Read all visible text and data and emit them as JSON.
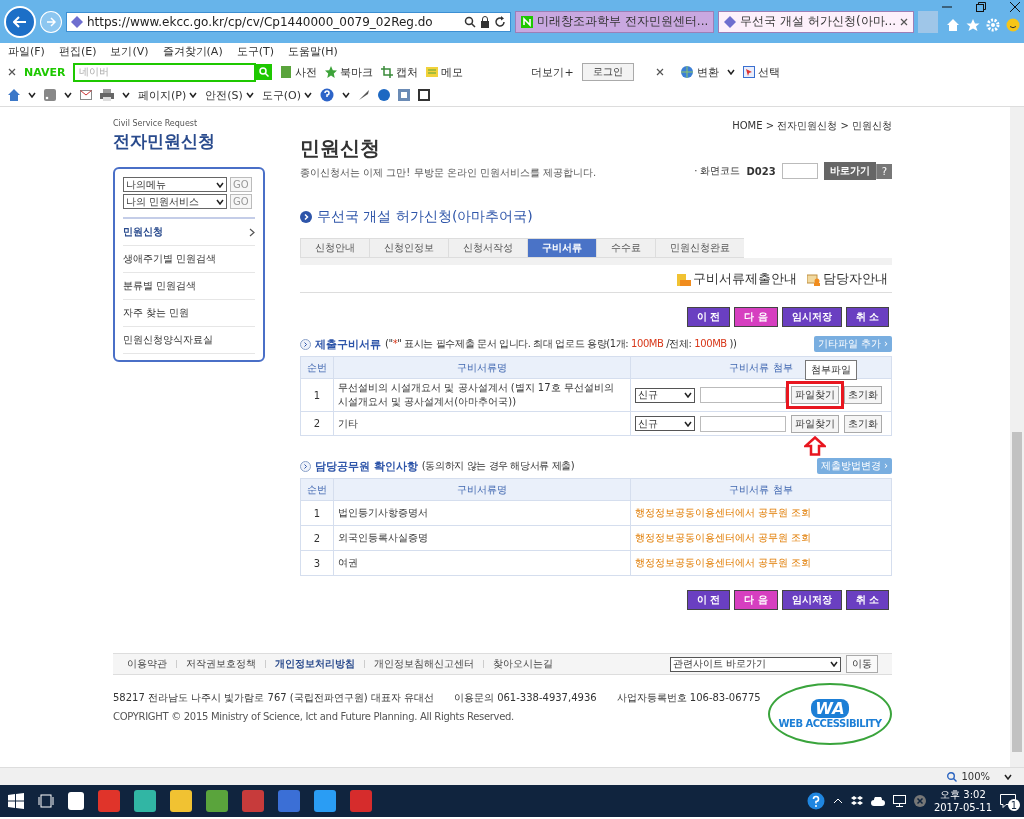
{
  "browser": {
    "url": "https://www.ekcc.go.kr/cp/cv/Cp1440000_0079_02Reg.do",
    "tabs": [
      {
        "title": "미래창조과학부 전자민원센터...",
        "selected": false
      },
      {
        "title": "무선국 개설 허가신청(아마...",
        "selected": true
      }
    ],
    "menu": [
      "파일(F)",
      "편집(E)",
      "보기(V)",
      "즐겨찾기(A)",
      "도구(T)",
      "도움말(H)"
    ],
    "naver": {
      "logo": "NAVER",
      "placeholder": "네이버",
      "items": [
        "사전",
        "북마크",
        "캡처",
        "메모"
      ],
      "more": "더보기+",
      "login": "로그인",
      "translate": "변환",
      "select": "선택"
    },
    "commands": [
      "페이지(P)",
      "안전(S)",
      "도구(O)"
    ]
  },
  "sidebar": {
    "subtitle": "Civil Service Request",
    "title": "전자민원신청",
    "selects": [
      {
        "value": "나의메뉴",
        "go": "GO"
      },
      {
        "value": "나의 민원서비스",
        "go": "GO"
      }
    ],
    "items": [
      {
        "label": "민원신청",
        "selected": true
      },
      {
        "label": "생애주기별 민원검색",
        "selected": false
      },
      {
        "label": "분류별 민원검색",
        "selected": false
      },
      {
        "label": "자주 찾는 민원",
        "selected": false
      },
      {
        "label": "민원신청양식자료실",
        "selected": false
      }
    ]
  },
  "page": {
    "breadcrumb": "HOME > 전자민원신청 > 민원신청",
    "title": "민원신청",
    "subtitle": "종이신청서는 이제 그만! 무방문 온라인 민원서비스를 제공합니다.",
    "screen_code": {
      "label": "· 화면코드",
      "code": "D023",
      "go": "바로가기",
      "help": "?"
    },
    "heading": "무선국 개설 허가신청(아마추어국)",
    "steps": [
      {
        "label": "신청안내",
        "selected": false
      },
      {
        "label": "신청인정보",
        "selected": false
      },
      {
        "label": "신청서작성",
        "selected": false
      },
      {
        "label": "구비서류",
        "selected": true
      },
      {
        "label": "수수료",
        "selected": false
      },
      {
        "label": "민원신청완료",
        "selected": false
      }
    ],
    "guides": [
      "구비서류제출안내",
      "담당자안내"
    ],
    "actions": [
      {
        "label": "이 전",
        "color": "#6a3fc1"
      },
      {
        "label": "다 음",
        "color": "#d63fc0"
      },
      {
        "label": "임시저장",
        "color": "#6a3fc1"
      },
      {
        "label": "취 소",
        "color": "#6a3fc1"
      }
    ],
    "documents": {
      "title": "제출구비서류",
      "note": [
        {
          "text": "(\"",
          "highlight": false
        },
        {
          "text": "*",
          "highlight": true
        },
        {
          "text": "\" 표시는 필수제출 문서 입니다. 최대 업로드 용량(1개: ",
          "highlight": false
        },
        {
          "text": "100MB",
          "highlight": true
        },
        {
          "text": " /전체: ",
          "highlight": false
        },
        {
          "text": "100MB",
          "highlight": true
        },
        {
          "text": " ))",
          "highlight": false
        }
      ],
      "add_button": "기타파일 추가 ›",
      "columns": [
        "순번",
        "구비서류명",
        "구비서류 첨부"
      ],
      "rows": [
        {
          "no": "1",
          "name": "무선설비의 시설개요서 및 공사설계서 (별지 17호 무선설비의 시설개요서 및 공사설계서(아마추어국))",
          "type": "신규",
          "browse": "파일찾기",
          "reset": "초기화",
          "marked": true
        },
        {
          "no": "2",
          "name": "기타",
          "type": "신규",
          "browse": "파일찾기",
          "reset": "초기화",
          "marked": false
        }
      ],
      "tooltip": "첨부파일"
    },
    "officer": {
      "title": "담당공무원 확인사항",
      "note": "(동의하지 않는 경우 해당서류 제출)",
      "button": "제출방법변경 ›",
      "columns": [
        "순번",
        "구비서류명",
        "구비서류 첨부"
      ],
      "rows": [
        {
          "no": "1",
          "name": "법인등기사항증명서",
          "attach": "행정정보공동이용센터에서 공무원 조회"
        },
        {
          "no": "2",
          "name": "외국인등록사실증명",
          "attach": "행정정보공동이용센터에서 공무원 조회"
        },
        {
          "no": "3",
          "name": "여권",
          "attach": "행정정보공동이용센터에서 공무원 조회"
        }
      ]
    },
    "actions_bottom": [
      {
        "label": "이 전",
        "color": "#6a3fc1"
      },
      {
        "label": "다 음",
        "color": "#d63fc0"
      },
      {
        "label": "임시저장",
        "color": "#6a3fc1"
      },
      {
        "label": "취 소",
        "color": "#6a3fc1"
      }
    ]
  },
  "footer": {
    "links": [
      {
        "label": "이용약관",
        "selected": false
      },
      {
        "label": "저작권보호정책",
        "selected": false
      },
      {
        "label": "개인정보처리방침",
        "selected": true
      },
      {
        "label": "개인정보침해신고센터",
        "selected": false
      },
      {
        "label": "찾아오시는길",
        "selected": false
      }
    ],
    "site_select": "관련사이트 바로가기",
    "move": "이동",
    "address": "58217 전라남도 나주시 빛가람로 767 (국립전파연구원) 대표자 유대선",
    "contact": "이용문의 061-338-4937,4936",
    "business": "사업자등록번호 106-83-06775",
    "copyright": "COPYRIGHT © 2015 Ministry of Science, Ict and Future Planning. All Rights Reserved.",
    "badge": {
      "mark": "WA",
      "caption": "WEB ACCESSIBILITY"
    }
  },
  "status_bar": {
    "zoom": "100%"
  },
  "taskbar": {
    "time": "오후 3:02",
    "date": "2017-05-11",
    "notifications": "1"
  }
}
